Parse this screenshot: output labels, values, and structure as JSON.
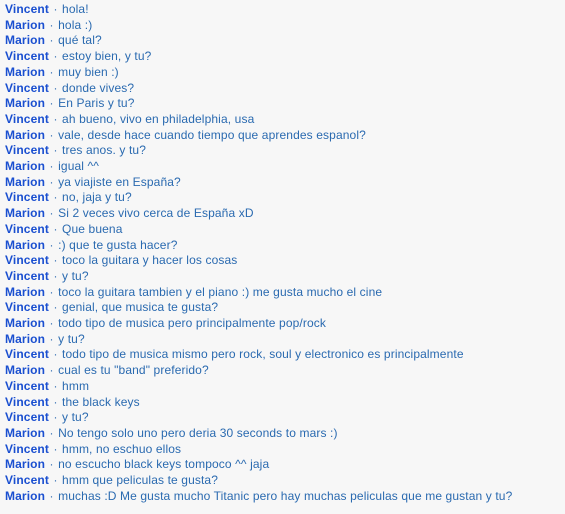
{
  "page": {
    "kind": "chat-transcript",
    "background_color": "#f7f7f7",
    "speaker_color": "#1a4fd0",
    "message_color": "#2a6ab0",
    "separator": "·"
  },
  "participants": [
    {
      "name": "Vincent"
    },
    {
      "name": "Marion"
    }
  ],
  "messages": [
    {
      "speaker": "Vincent",
      "text": "hola!"
    },
    {
      "speaker": "Marion",
      "text": "hola :)"
    },
    {
      "speaker": "Marion",
      "text": "qué tal?"
    },
    {
      "speaker": "Vincent",
      "text": "estoy bien, y tu?"
    },
    {
      "speaker": "Marion",
      "text": "muy bien :)"
    },
    {
      "speaker": "Vincent",
      "text": "donde vives?"
    },
    {
      "speaker": "Marion",
      "text": "En Paris y tu?"
    },
    {
      "speaker": "Vincent",
      "text": "ah bueno, vivo en philadelphia, usa"
    },
    {
      "speaker": "Marion",
      "text": "vale, desde hace cuando tiempo que aprendes espanol?"
    },
    {
      "speaker": "Vincent",
      "text": "tres anos. y tu?"
    },
    {
      "speaker": "Marion",
      "text": "igual ^^"
    },
    {
      "speaker": "Marion",
      "text": "ya viajiste en España?"
    },
    {
      "speaker": "Vincent",
      "text": "no, jaja y tu?"
    },
    {
      "speaker": "Marion",
      "text": "Si 2 veces vivo cerca de España xD"
    },
    {
      "speaker": "Vincent",
      "text": "Que buena"
    },
    {
      "speaker": "Marion",
      "text": ":) que te gusta hacer?"
    },
    {
      "speaker": "Vincent",
      "text": "toco la guitara y hacer los cosas"
    },
    {
      "speaker": "Vincent",
      "text": "y tu?"
    },
    {
      "speaker": "Marion",
      "text": "toco la guitara tambien y el piano :) me gusta mucho el cine"
    },
    {
      "speaker": "Vincent",
      "text": "genial, que musica te gusta?"
    },
    {
      "speaker": "Marion",
      "text": "todo tipo de musica pero principalmente pop/rock"
    },
    {
      "speaker": "Marion",
      "text": "y tu?"
    },
    {
      "speaker": "Vincent",
      "text": "todo tipo de musica mismo pero rock, soul y electronico es principalmente"
    },
    {
      "speaker": "Marion",
      "text": "cual es tu \"band\" preferido?"
    },
    {
      "speaker": "Vincent",
      "text": "hmm"
    },
    {
      "speaker": "Vincent",
      "text": "the black keys"
    },
    {
      "speaker": "Vincent",
      "text": "y tu?"
    },
    {
      "speaker": "Marion",
      "text": "No tengo solo uno pero deria 30 seconds to mars :)"
    },
    {
      "speaker": "Vincent",
      "text": "hmm, no eschuo ellos"
    },
    {
      "speaker": "Marion",
      "text": "no escucho black keys tompoco ^^ jaja"
    },
    {
      "speaker": "Vincent",
      "text": "hmm que peliculas te gusta?"
    },
    {
      "speaker": "Marion",
      "text": "muchas :D Me gusta mucho Titanic pero hay muchas peliculas que me gustan y tu?"
    }
  ]
}
